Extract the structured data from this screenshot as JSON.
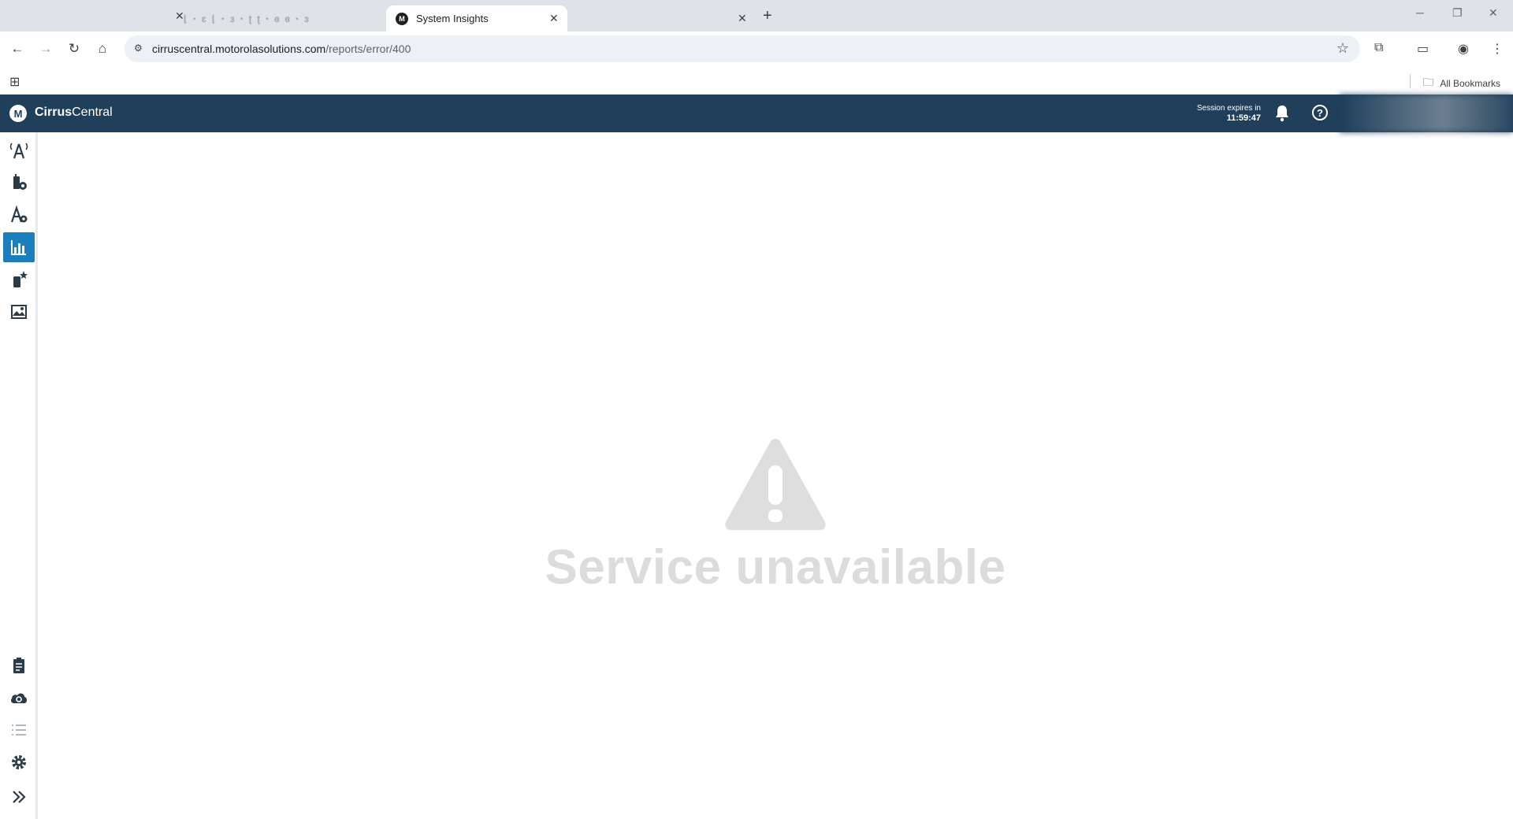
{
  "browser": {
    "tabs": [
      {
        "title": "⌊ ꞏ ɛ  ⌊ ꞏ ɜ  ꞏ ʈ ʈ  ꞏ ɞ ɞ  ꞏ ɜ",
        "active": false
      },
      {
        "title": "System Insights",
        "active": true,
        "favicon": "M"
      },
      {
        "title": "",
        "active": false
      }
    ],
    "new_tab_symbol": "+",
    "url_host": "cirruscentral.motorolasolutions.com",
    "url_path": "/reports/error/400",
    "bookmarks_label": "All Bookmarks"
  },
  "app": {
    "logo_letter": "M",
    "brand_bold": "Cirrus",
    "brand_regular": "Central",
    "session_label": "Session expires in",
    "session_time": "11:59:47"
  },
  "sidebar": {
    "items": [
      {
        "name": "sites-radio-icon",
        "glyph": "(Ⓐ)"
      },
      {
        "name": "device-config-icon",
        "glyph": "⚙"
      },
      {
        "name": "admin-settings-icon",
        "glyph": "A⚙"
      },
      {
        "name": "reports-icon",
        "glyph": "▮▮",
        "active": true
      },
      {
        "name": "programming-icon",
        "glyph": "✱"
      },
      {
        "name": "map-icon",
        "glyph": "▦"
      }
    ],
    "bottom_items": [
      {
        "name": "clipboard-icon"
      },
      {
        "name": "cloud-sync-icon"
      },
      {
        "name": "list-icon"
      },
      {
        "name": "settings-gear-icon"
      },
      {
        "name": "expand-icon"
      }
    ]
  },
  "main": {
    "error_message": "Service unavailable"
  },
  "colors": {
    "header_bg": "#1f3f5a",
    "active_accent": "#1c7fbd",
    "error_gray": "#dcdcdc"
  }
}
